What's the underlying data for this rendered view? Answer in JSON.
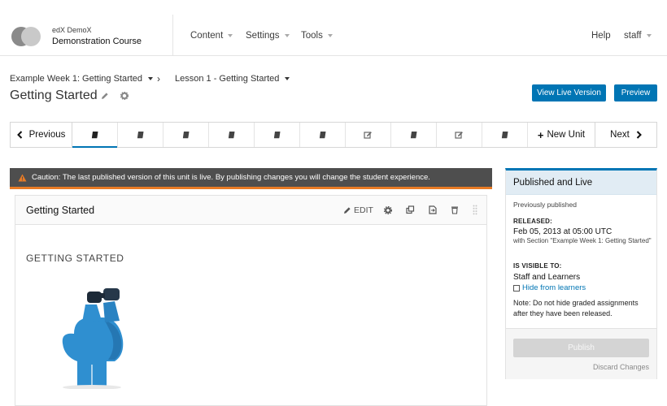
{
  "header": {
    "course_org": "edX  DemoX",
    "course_name": "Demonstration Course",
    "nav": [
      {
        "label": "Content"
      },
      {
        "label": "Settings"
      },
      {
        "label": "Tools"
      }
    ],
    "help_label": "Help",
    "user_label": "staff"
  },
  "breadcrumb": {
    "section": "Example Week 1: Getting Started",
    "separator": "›",
    "subsection": "Lesson 1 - Getting Started"
  },
  "unit": {
    "title": "Getting Started",
    "view_live_label": "View Live Version",
    "preview_label": "Preview"
  },
  "unit_nav": {
    "previous_label": "Previous",
    "new_unit_label": "New Unit",
    "next_label": "Next",
    "units": [
      {
        "icon": "book-icon"
      },
      {
        "icon": "book-icon"
      },
      {
        "icon": "book-icon"
      },
      {
        "icon": "book-icon"
      },
      {
        "icon": "book-icon"
      },
      {
        "icon": "book-icon"
      },
      {
        "icon": "edit-square-icon"
      },
      {
        "icon": "book-icon"
      },
      {
        "icon": "edit-square-icon"
      },
      {
        "icon": "book-icon"
      }
    ]
  },
  "caution": {
    "text": "Caution: The last published version of this unit is live. By publishing changes you will change the student experience."
  },
  "xblock": {
    "title": "Getting Started",
    "edit_label": "EDIT",
    "content_heading": "GETTING STARTED"
  },
  "sidebar": {
    "title": "Published and Live",
    "status_text": "Previously published",
    "released_label": "RELEASED:",
    "released_value": "Feb 05, 2013 at 05:00 UTC",
    "released_section": "with Section \"Example Week 1: Getting Started\"",
    "visible_label": "IS VISIBLE TO:",
    "visible_value": "Staff and Learners",
    "hide_label": "Hide from learners",
    "note": "Note: Do not hide graded assignments after they have been released.",
    "publish_label": "Publish",
    "discard_label": "Discard Changes"
  },
  "colors": {
    "accent_blue": "#0075b4",
    "caution_bg": "#4e4e4e",
    "caution_border": "#e87b25",
    "sidebar_header_bg": "#e1ecf4",
    "figure_blue": "#2f8fd0"
  }
}
